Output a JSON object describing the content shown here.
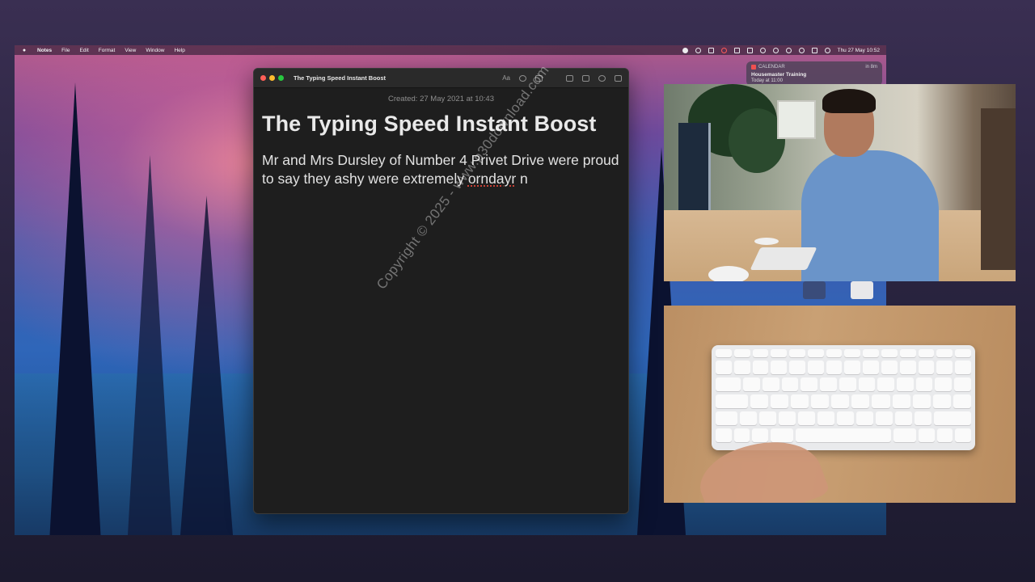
{
  "menubar": {
    "apple": "",
    "app_name": "Notes",
    "menus": [
      "File",
      "Edit",
      "Format",
      "View",
      "Window",
      "Help"
    ],
    "tray_icons": [
      "record-icon",
      "info-icon",
      "screen-icon",
      "cloud-icon",
      "video-icon",
      "flag-icon",
      "bluetooth-icon",
      "clock-icon",
      "wifi-icon",
      "search-icon",
      "controlcenter-icon",
      "siri-icon"
    ],
    "datetime": "Thu 27 May  10:52"
  },
  "notification": {
    "app": "CALENDAR",
    "time": "in 8m",
    "title": "Housemaster Training",
    "subtitle": "Today at 11:00"
  },
  "notes_window": {
    "title": "The Typing Speed Instant Boost",
    "toolbar": {
      "format_label": "Aa"
    },
    "created": "Created: 27 May 2021 at 10:43",
    "heading": "The Typing Speed Instant Boost",
    "body_before": "Mr and Mrs Dursley of Number 4 Privet Drive were proud to say they ashy were extremely ",
    "body_misspelled": "orndayr",
    "body_after": " n"
  },
  "watermark": "Copyright © 2025 - www.p30download.com",
  "colors": {
    "notes_bg": "#1e1e1e",
    "menubar_bg": "#1a1626",
    "accent_red": "#fe5f57",
    "accent_yellow": "#febc2e",
    "accent_green": "#28c840"
  }
}
